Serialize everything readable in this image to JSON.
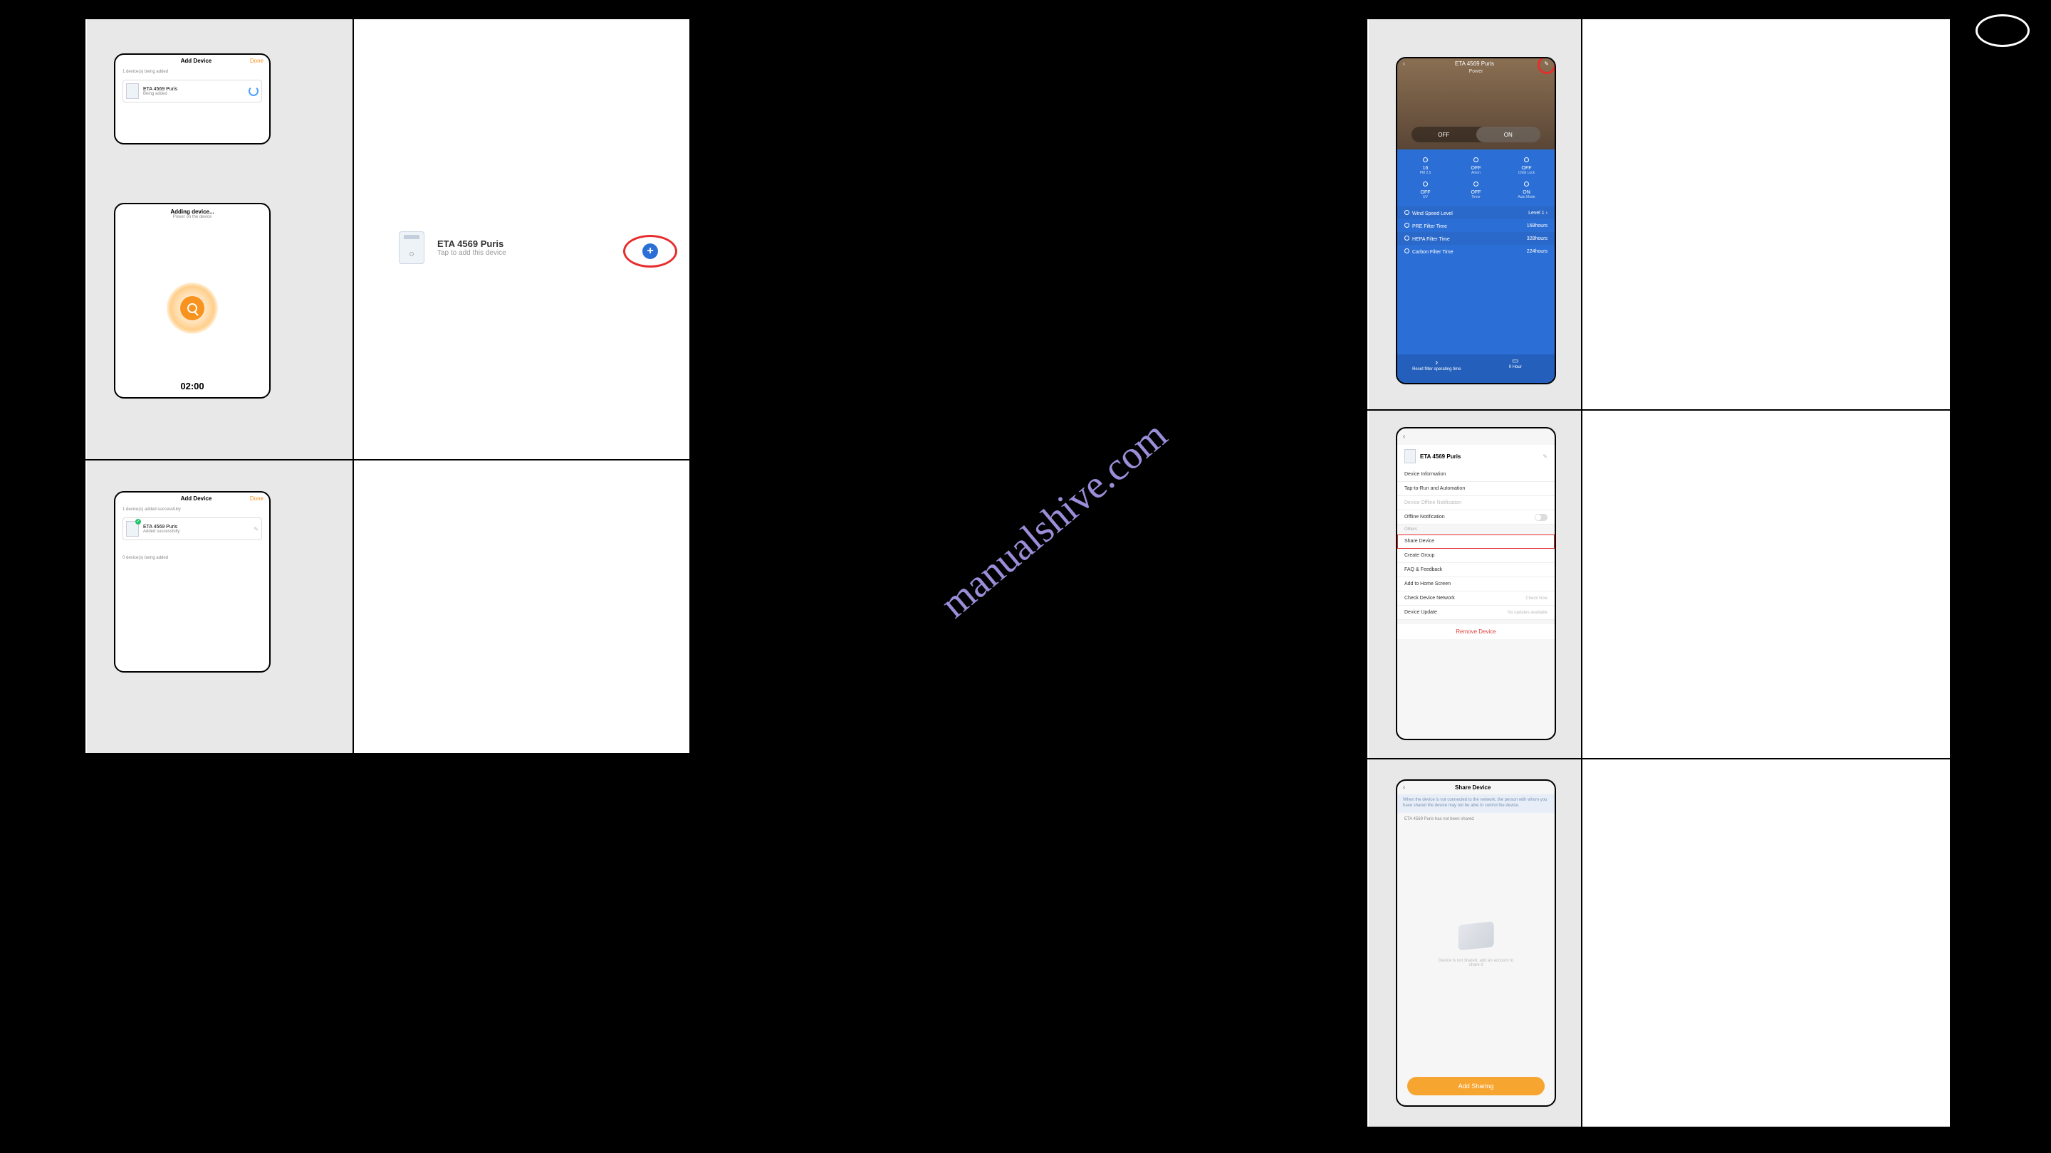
{
  "watermark": "manualshive.com",
  "left": {
    "screen_a": {
      "title": "Add Device",
      "done": "Done",
      "hint": "1 device(s) being added",
      "card": {
        "name": "ETA 4569 Puris",
        "status": "Being added"
      }
    },
    "screen_b": {
      "title": "Adding device...",
      "hint": "Power on the device",
      "timer": "02:00"
    },
    "main_card": {
      "name": "ETA 4569 Puris",
      "sub": "Tap to add this device"
    },
    "screen_c": {
      "title": "Add Device",
      "done": "Done",
      "hint": "1 device(s) added successfully",
      "card": {
        "name": "ETA 4569 Puris",
        "status": "Added successfully"
      },
      "hint2": "0 device(s) being added"
    }
  },
  "right": {
    "control": {
      "title": "ETA 4569 Puris",
      "sub": "Power",
      "off": "OFF",
      "on": "ON",
      "tiles": [
        {
          "val": "16",
          "lbl": "PM 2.5"
        },
        {
          "val": "OFF",
          "lbl": "Anion"
        },
        {
          "val": "OFF",
          "lbl": "Child Lock"
        },
        {
          "val": "OFF",
          "lbl": "UV"
        },
        {
          "val": "OFF",
          "lbl": "Timer"
        },
        {
          "val": "ON",
          "lbl": "Auto Mode"
        }
      ],
      "rows": [
        {
          "l": "Wind Speed Level",
          "r": "Level 1"
        },
        {
          "l": "PRE Filter Time",
          "r": "168hours"
        },
        {
          "l": "HEPA Filter Time",
          "r": "328hours"
        },
        {
          "l": "Carbon Filter Time",
          "r": "224hours"
        }
      ],
      "foot": {
        "l": "Reset filter operating time",
        "r": "0 Hour"
      }
    },
    "settings": {
      "title": "ETA 4569 Puris",
      "items": [
        {
          "t": "Device Information"
        },
        {
          "t": "Tap-to-Run and Automation"
        },
        {
          "t": "Device Offline Notification",
          "muted": true
        },
        {
          "t": "Offline Notification",
          "toggle": true
        },
        {
          "t": "Others",
          "section": true
        },
        {
          "t": "Share Device",
          "hl": true
        },
        {
          "t": "Create Group"
        },
        {
          "t": "FAQ & Feedback"
        },
        {
          "t": "Add to Home Screen"
        },
        {
          "t": "Check Device Network",
          "r": "Check Now"
        },
        {
          "t": "Device Update",
          "r": "No updates available"
        }
      ],
      "remove": "Remove Device"
    },
    "share": {
      "title": "Share Device",
      "banner": "When the device is not connected to the network, the person with whom you have shared the device may not be able to control the device.",
      "empty": "ETA 4569 Puris has not been shared",
      "btn": "Add Sharing"
    }
  }
}
